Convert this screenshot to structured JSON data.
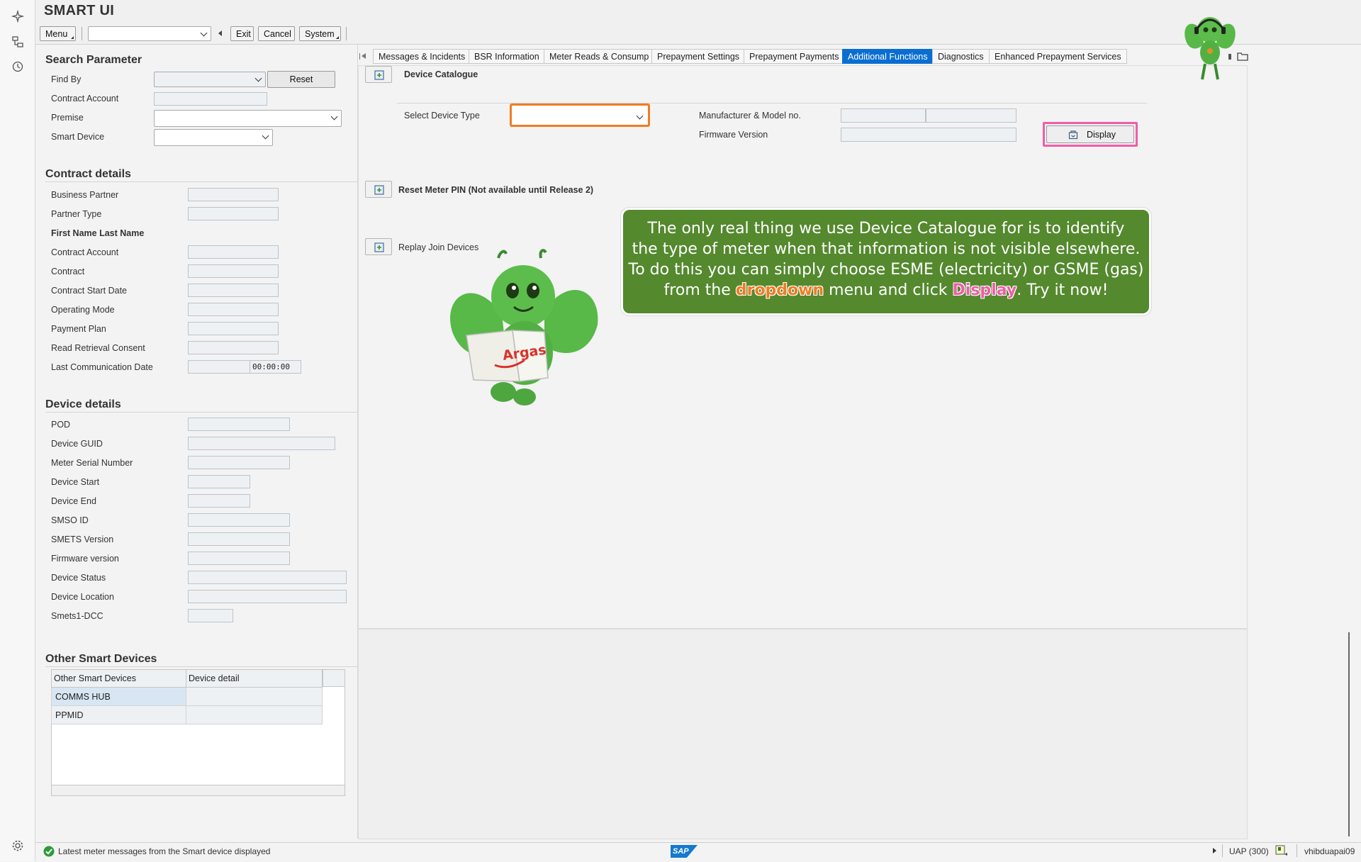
{
  "app": {
    "title": "SMART UI"
  },
  "toolbar": {
    "menu": "Menu",
    "exit": "Exit",
    "cancel": "Cancel",
    "system": "System",
    "command_value": ""
  },
  "search": {
    "heading": "Search Parameter",
    "find_by": "Find By",
    "reset": "Reset",
    "contract_account": "Contract Account",
    "premise": "Premise",
    "smart_device": "Smart Device"
  },
  "contract": {
    "heading": "Contract details",
    "business_partner": "Business Partner",
    "partner_type": "Partner Type",
    "name": "First Name Last Name",
    "contract_account": "Contract Account",
    "contract": "Contract",
    "contract_start_date": "Contract Start Date",
    "operating_mode": "Operating Mode",
    "payment_plan": "Payment Plan",
    "read_retrieval_consent": "Read Retrieval Consent",
    "last_comm_date": "Last Communication Date",
    "last_comm_time": "00:00:00"
  },
  "device": {
    "heading": "Device details",
    "pod": "POD",
    "guid": "Device GUID",
    "serial": "Meter Serial Number",
    "start": "Device Start",
    "end": "Device End",
    "smso": "SMSO ID",
    "smets": "SMETS Version",
    "firmware": "Firmware version",
    "status": "Device Status",
    "location": "Device Location",
    "smets1": "Smets1-DCC"
  },
  "other": {
    "heading": "Other Smart Devices",
    "col1": "Other Smart Devices",
    "col2": "Device detail",
    "rows": [
      "COMMS HUB",
      "PPMID"
    ]
  },
  "tabs": [
    "Messages & Incidents",
    "BSR Information",
    "Meter Reads & Consump",
    "Prepayment Settings",
    "Prepayment Payments",
    "Additional Functions",
    "Diagnostics",
    "Enhanced Prepayment Services"
  ],
  "additional": {
    "device_catalogue": "Device Catalogue",
    "select_device_type": "Select Device Type",
    "manufacturer": "Manufacturer & Model no.",
    "firmware": "Firmware Version",
    "display": "Display",
    "reset_pin": "Reset Meter PIN (Not available until Release 2)",
    "replay_join": "Replay Join Devices"
  },
  "tip": {
    "line1": "The only real thing we use Device Catalogue for is to identify",
    "line2": "the type of meter when that information is not visible elsewhere.",
    "line3": "To do this you can simply choose ESME (electricity) or GSME (gas)",
    "line4a": "from the ",
    "dropdown": "dropdown",
    "line4b": " menu and click ",
    "display": "Display",
    "line4c": ". Try it now!",
    "book_text": "Argas"
  },
  "status": {
    "message": "Latest meter messages from the Smart device displayed",
    "system": "UAP (300)",
    "user": "vhibduapai09",
    "logo": "SAP"
  },
  "colors": {
    "accent": "#0a6ed1",
    "tip_bg": "#54892e",
    "highlight_orange": "#ef7d22",
    "highlight_pink": "#ee5ea6"
  }
}
